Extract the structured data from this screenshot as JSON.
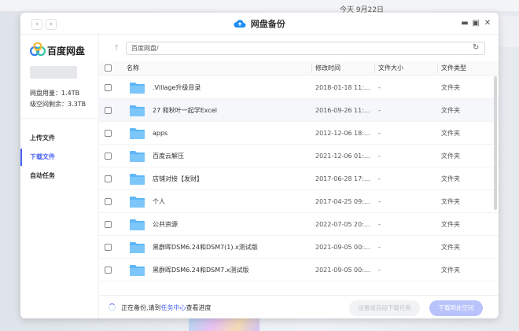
{
  "desktop": {
    "date": "今天 9月22日"
  },
  "window": {
    "title": "网盘备份"
  },
  "sidebar": {
    "brand": "百度网盘",
    "quota_used": "网盘用量：1.4TB",
    "quota_free": "级空间剩余：3.3TB",
    "items": [
      {
        "label": "上传文件",
        "active": false
      },
      {
        "label": "下载文件",
        "active": true
      },
      {
        "label": "自动任务",
        "active": false
      }
    ]
  },
  "toolbar": {
    "path": "百度网盘/"
  },
  "table": {
    "headers": {
      "name": "名称",
      "modified": "修改时间",
      "size": "文件大小",
      "type": "文件类型"
    },
    "rows": [
      {
        "name": ".Village升级目录",
        "modified": "2018-01-18 11:...",
        "size": "-",
        "type": "文件夹"
      },
      {
        "name": "27 和秋叶一起学Excel",
        "modified": "2016-09-26 11:...",
        "size": "-",
        "type": "文件夹"
      },
      {
        "name": "apps",
        "modified": "2012-12-06 18:...",
        "size": "-",
        "type": "文件夹"
      },
      {
        "name": "百度云解压",
        "modified": "2021-12-06 01:...",
        "size": "-",
        "type": "文件夹"
      },
      {
        "name": "店铺对接【发财】",
        "modified": "2017-06-28 17:...",
        "size": "-",
        "type": "文件夹"
      },
      {
        "name": "个人",
        "modified": "2017-04-25 09:...",
        "size": "-",
        "type": "文件夹"
      },
      {
        "name": "公共资源",
        "modified": "2022-07-05 20:...",
        "size": "-",
        "type": "文件夹"
      },
      {
        "name": "黑群晖DSM6.24和DSM7(1).x测试版",
        "modified": "2021-09-05 00:...",
        "size": "-",
        "type": "文件夹"
      },
      {
        "name": "黑群晖DSM6.24和DSM7.x测试版",
        "modified": "2021-09-05 00:...",
        "size": "-",
        "type": "文件夹"
      }
    ]
  },
  "footer": {
    "status_prefix": "正在备份,请到",
    "status_link": "任务中心",
    "status_suffix": "查看进度",
    "secondary_button": "设置成自动下载任务",
    "primary_button": "下载到此空间"
  },
  "colors": {
    "accent": "#4a63f5",
    "folder": "#5eb6f7"
  }
}
